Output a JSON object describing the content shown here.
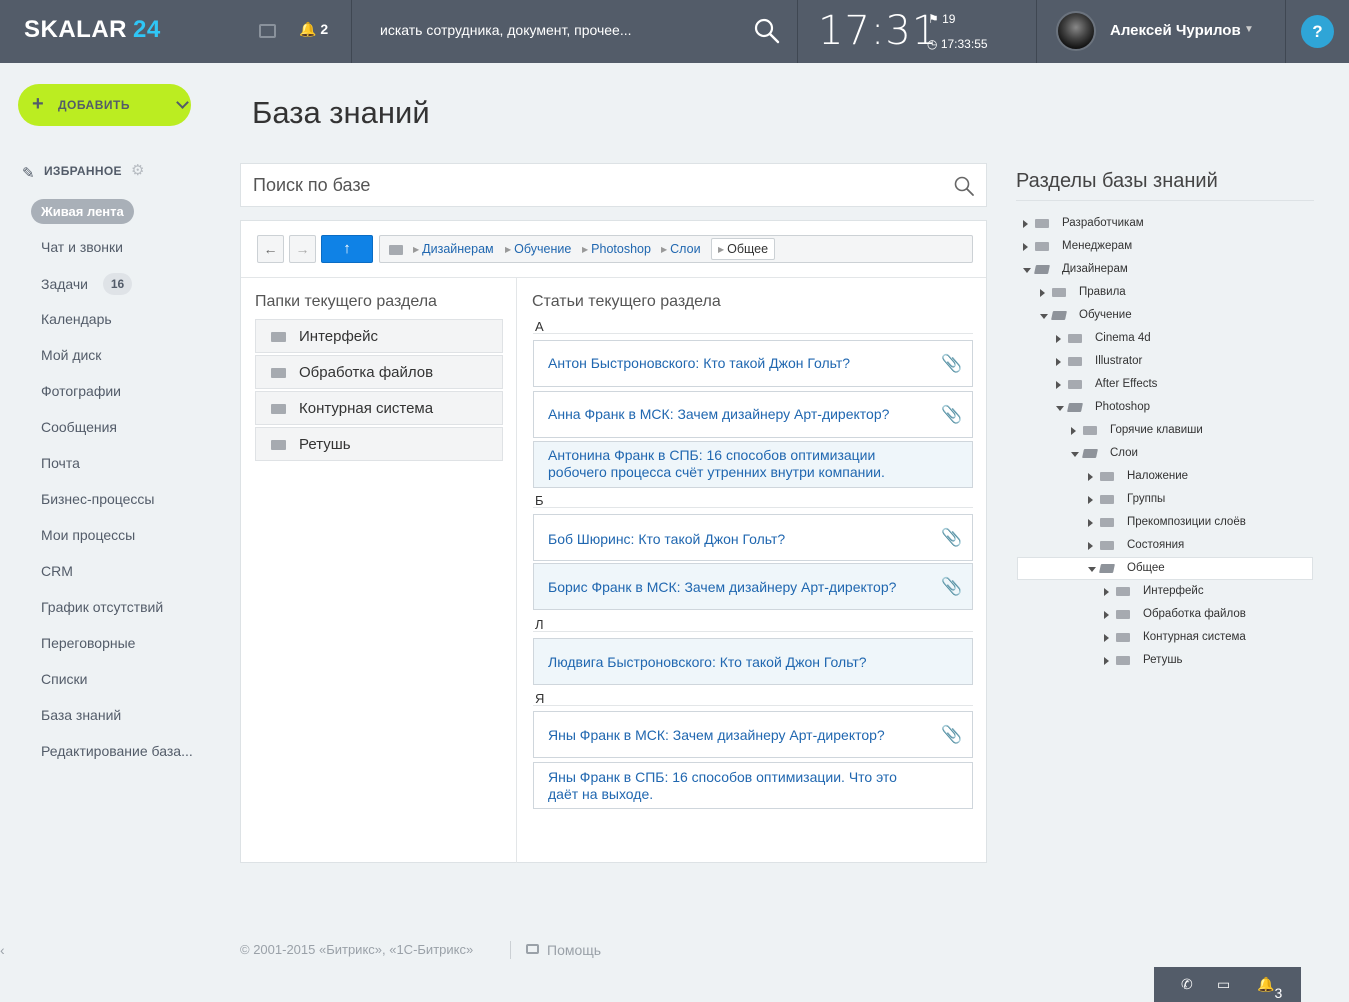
{
  "header": {
    "logo_text": "SKALAR",
    "logo_num": "24",
    "notif_count": "2",
    "search_placeholder": "искать сотрудника, документ, прочее...",
    "time": "17:31",
    "flag_count": "19",
    "timer": "17:33:55",
    "user_name": "Алексей Чурилов",
    "help_label": "?",
    "accent_color": "#2fc6f6"
  },
  "sidebar": {
    "add_label": "ДОБАВИТЬ",
    "favorites_title": "ИЗБРАННОЕ",
    "active_item": "Живая лента",
    "tasks_badge": "16",
    "items": [
      "Чат и звонки",
      "Задачи",
      "Календарь",
      "Мой диск",
      "Фотографии",
      "Сообщения",
      "Почта",
      "Бизнес-процессы",
      "Мои процессы",
      "CRM",
      "График отсутствий",
      "Переговорные",
      "Списки",
      "База знаний",
      "Редактирование база..."
    ]
  },
  "main": {
    "title": "База знаний",
    "search_placeholder": "Поиск по базе",
    "breadcrumb": [
      "Дизайнерам",
      "Обучение",
      "Photoshop",
      "Слои"
    ],
    "breadcrumb_current": "Общее",
    "folders_title": "Папки текущего раздела",
    "folders": [
      "Интерфейс",
      "Обработка файлов",
      "Контурная система",
      "Ретушь"
    ],
    "articles_title": "Статьи текущего раздела",
    "letters": [
      "А",
      "Б",
      "Л",
      "Я"
    ],
    "articles": [
      "Антон Быстроновского: Кто такой Джон Гольт?",
      "Анна Франк в МСК: Зачем дизайнеру Арт-директор?",
      "Антонина Франк в СПБ: 16 способов оптимизации",
      "робочего процесса счёт утренних внутри компании.",
      "Боб Шюринс: Кто такой Джон Гольт?",
      "Борис Франк в МСК: Зачем дизайнеру Арт-директор?",
      "Людвига Быстроновского: Кто такой Джон Гольт?",
      "Яны Франк в МСК: Зачем дизайнеру Арт-директор?",
      "Яны Франк в СПБ: 16 способов оптимизации. Что это",
      "даёт на выходе."
    ]
  },
  "tree": {
    "title": "Разделы базы знаний",
    "items": [
      "Разработчикам",
      "Менеджерам",
      "Дизайнерам",
      "Правила",
      "Обучение",
      "Cinema 4d",
      "Illustrator",
      "After Effects",
      "Photoshop",
      "Горячие клавиши",
      "Слои",
      "Наложение",
      "Группы",
      "Прекомпозиции слоёв",
      "Состояния",
      "Общее",
      "Интерфейс",
      "Обработка файлов",
      "Контурная система",
      "Ретушь"
    ]
  },
  "footer": {
    "copyright": "© 2001-2015 «Битрикс», «1С-Битрикс»",
    "help": "Помощь",
    "bottom_notif": "3"
  }
}
